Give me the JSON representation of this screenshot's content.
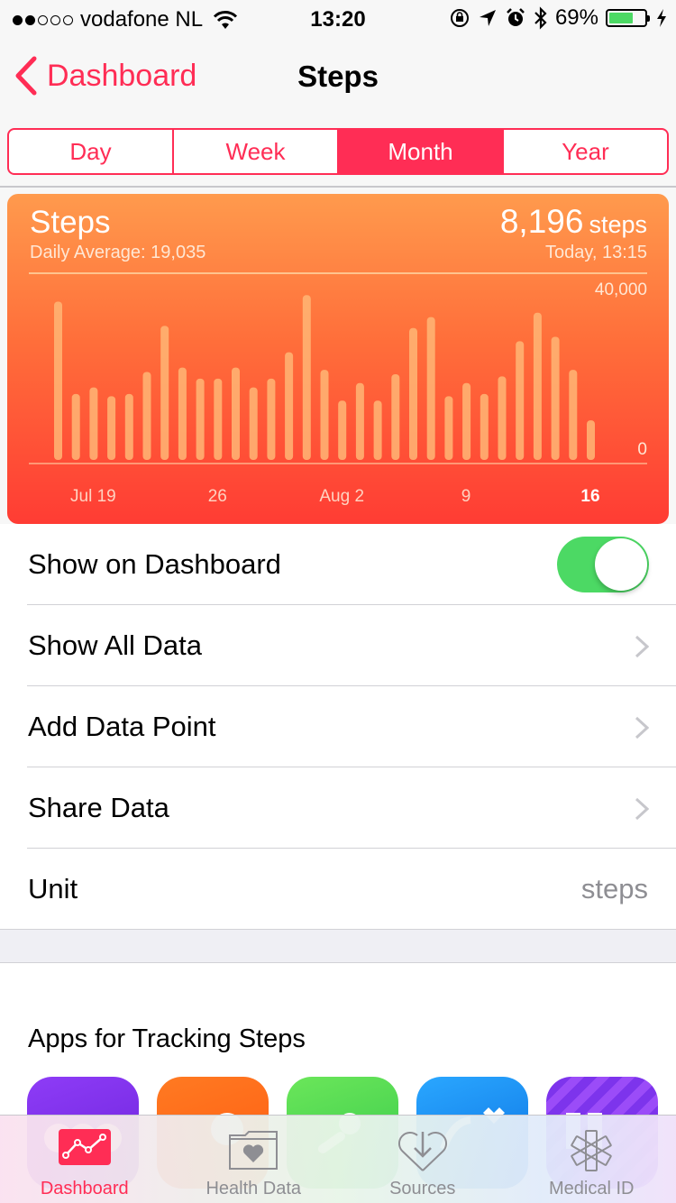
{
  "status_bar": {
    "carrier": "vodafone NL",
    "signal_dots_filled": 2,
    "signal_dots_total": 5,
    "time": "13:20",
    "battery_percent": "69%",
    "battery_level": 0.69
  },
  "nav": {
    "back_label": "Dashboard",
    "title": "Steps"
  },
  "segments": [
    {
      "label": "Day",
      "active": false
    },
    {
      "label": "Week",
      "active": false
    },
    {
      "label": "Month",
      "active": true
    },
    {
      "label": "Year",
      "active": false
    }
  ],
  "summary": {
    "title": "Steps",
    "daily_average": "Daily Average: 19,035",
    "value": "8,196",
    "unit": "steps",
    "date": "Today, 13:15"
  },
  "chart_data": {
    "type": "bar",
    "ylim": [
      0,
      40000
    ],
    "y_tick_labels": [
      "40,000",
      "0"
    ],
    "x_tick_labels": [
      "Jul 19",
      "26",
      "Aug 2",
      "9",
      "16"
    ],
    "x_tick_label_bold": "16",
    "values": [
      36000,
      15000,
      16500,
      14500,
      15000,
      20000,
      30500,
      21000,
      18500,
      18500,
      21000,
      16500,
      18500,
      24500,
      37500,
      20500,
      13500,
      17500,
      13500,
      19500,
      30000,
      32500,
      14500,
      17500,
      15000,
      19000,
      27000,
      33500,
      28000,
      20500,
      9000
    ],
    "tick_positions": [
      2,
      9,
      16,
      23,
      30
    ],
    "grid": true
  },
  "list": {
    "show_on_dashboard": "Show on Dashboard",
    "show_on_dashboard_enabled": true,
    "show_all_data": "Show All Data",
    "add_data_point": "Add Data Point",
    "share_data": "Share Data",
    "unit_label": "Unit",
    "unit_value": "steps"
  },
  "apps": {
    "title": "Apps for Tracking Steps",
    "icons": [
      {
        "name": "purple-app-icon",
        "color": "#7b2ff0"
      },
      {
        "name": "orange-app-icon",
        "color": "#ff6a1a"
      },
      {
        "name": "green-app-icon",
        "color": "#4cd964"
      },
      {
        "name": "blue-app-icon",
        "color": "#1a8cff"
      },
      {
        "name": "violet-app-icon",
        "color": "#8a3ef5"
      }
    ]
  },
  "tabs": [
    {
      "label": "Dashboard",
      "icon": "dashboard-icon",
      "active": true
    },
    {
      "label": "Health Data",
      "icon": "health-data-icon",
      "active": false
    },
    {
      "label": "Sources",
      "icon": "sources-icon",
      "active": false
    },
    {
      "label": "Medical ID",
      "icon": "medical-id-icon",
      "active": false
    }
  ],
  "colors": {
    "accent": "#ff2d55",
    "toggle_on": "#4cd964",
    "card_top": "#ff9a4d",
    "card_bottom": "#ff3c34"
  }
}
